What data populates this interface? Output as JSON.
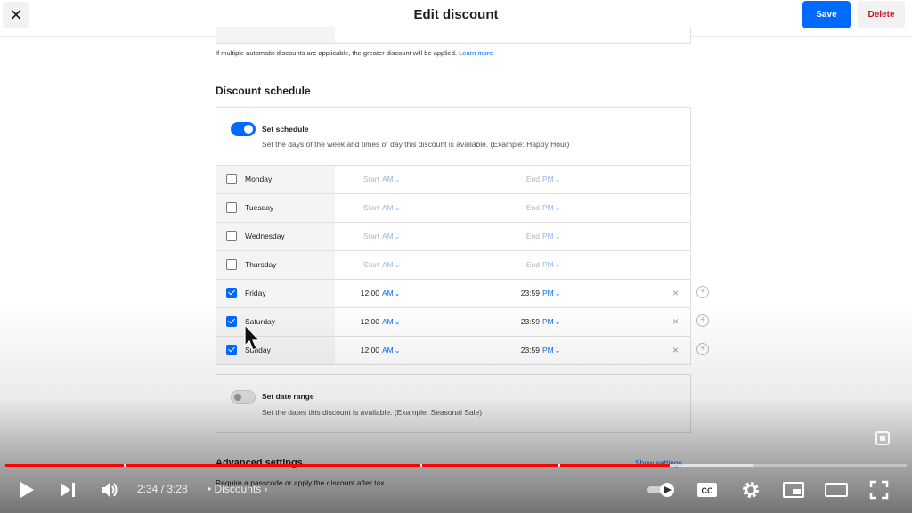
{
  "header": {
    "title": "Edit discount",
    "close_symbol": "✕",
    "save_label": "Save",
    "delete_label": "Delete"
  },
  "note": {
    "text": "If multiple automatic discounts are applicable, the greater discount will be applied.",
    "link": "Learn more"
  },
  "schedule": {
    "section_title": "Discount schedule",
    "toggle_label": "Set schedule",
    "toggle_on": true,
    "description": "Set the days of the week and times of day this discount is available. (Example: Happy Hour)",
    "days": [
      {
        "name": "Monday",
        "checked": false,
        "start": "Start",
        "start_ampm": "AM",
        "end": "End",
        "end_ampm": "PM"
      },
      {
        "name": "Tuesday",
        "checked": false,
        "start": "Start",
        "start_ampm": "AM",
        "end": "End",
        "end_ampm": "PM"
      },
      {
        "name": "Wednesday",
        "checked": false,
        "start": "Start",
        "start_ampm": "AM",
        "end": "End",
        "end_ampm": "PM"
      },
      {
        "name": "Thursday",
        "checked": false,
        "start": "Start",
        "start_ampm": "AM",
        "end": "End",
        "end_ampm": "PM"
      },
      {
        "name": "Friday",
        "checked": true,
        "start": "12:00",
        "start_ampm": "AM",
        "end": "23:59",
        "end_ampm": "PM"
      },
      {
        "name": "Saturday",
        "checked": true,
        "start": "12:00",
        "start_ampm": "AM",
        "end": "23:59",
        "end_ampm": "PM"
      },
      {
        "name": "Sunday",
        "checked": true,
        "start": "12:00",
        "start_ampm": "AM",
        "end": "23:59",
        "end_ampm": "PM"
      }
    ]
  },
  "date_range": {
    "toggle_label": "Set date range",
    "toggle_on": false,
    "description": "Set the dates this discount is available. (Example: Seasonal Sale)"
  },
  "advanced": {
    "title": "Advanced settings",
    "link": "Show settings",
    "description": "Require a passcode or apply the discount after tax."
  },
  "player": {
    "time": "2:34 / 3:28",
    "chapter": "• Discounts ›",
    "progress_fraction": 0.737,
    "buffer_fraction": 0.83
  },
  "colors": {
    "accent": "#006aff",
    "delete": "#c7162b",
    "progress": "#ff0000"
  }
}
